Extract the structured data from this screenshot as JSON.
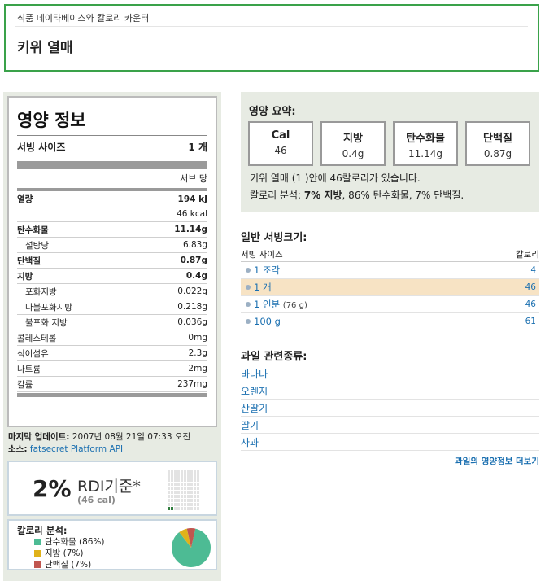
{
  "header": {
    "breadcrumb": "식품 데이타베이스와 칼로리 카운터",
    "title": "키위 열매"
  },
  "facts": {
    "title": "영양 정보",
    "serving_label": "서빙 사이즈",
    "serving_value": "1 개",
    "per_label": "서브 당",
    "energy": {
      "label": "열량",
      "kj": "194 kJ",
      "kcal": "46 kcal"
    },
    "rows": [
      {
        "name": "탄수화물",
        "value": "11.14g",
        "style": "bold"
      },
      {
        "name": "설탕당",
        "value": "6.83g",
        "style": "sub"
      },
      {
        "name": "단백질",
        "value": "0.87g",
        "style": "bold"
      },
      {
        "name": "지방",
        "value": "0.4g",
        "style": "bold"
      },
      {
        "name": "포화지방",
        "value": "0.022g",
        "style": "sub"
      },
      {
        "name": "다불포화지방",
        "value": "0.218g",
        "style": "sub"
      },
      {
        "name": "불포화 지방",
        "value": "0.036g",
        "style": "sub"
      },
      {
        "name": "콜레스테롤",
        "value": "0mg",
        "style": "normal"
      },
      {
        "name": "식이섬유",
        "value": "2.3g",
        "style": "normal"
      },
      {
        "name": "나트륨",
        "value": "2mg",
        "style": "normal"
      },
      {
        "name": "칼륨",
        "value": "237mg",
        "style": "normal"
      }
    ]
  },
  "updated": {
    "label": "마지막 업데이트:",
    "value": "2007년 08월 21일 07:33 오전",
    "source_label": "소스:",
    "source_link": "fatsecret Platform API"
  },
  "rdi": {
    "percent": "2%",
    "label": "RDI기준*",
    "cal": "(46 cal)",
    "fraction": 0.02
  },
  "breakdown": {
    "title": "칼로리 분석:",
    "items": [
      {
        "label": "탄수화물 (86%)",
        "value": 86,
        "color": "#4dbb94"
      },
      {
        "label": "지방 (7%)",
        "value": 7,
        "color": "#e0b21a"
      },
      {
        "label": "단백질 (7%)",
        "value": 7,
        "color": "#c0564f"
      }
    ]
  },
  "summary": {
    "title": "영양 요약:",
    "boxes": [
      {
        "key": "Cal",
        "value": "46"
      },
      {
        "key": "지방",
        "value": "0.4g"
      },
      {
        "key": "탄수화물",
        "value": "11.14g"
      },
      {
        "key": "단백질",
        "value": "0.87g"
      }
    ],
    "line1": "키위 열매 (1 )안에 46칼로리가 있습니다.",
    "line2_prefix": "칼로리 분석: ",
    "line2_bold": "7% 지방",
    "line2_rest": ", 86% 탄수화물, 7% 단백질."
  },
  "servings": {
    "title": "일반 서빙크기:",
    "col_size": "서빙 사이즈",
    "col_cal": "칼로리",
    "rows": [
      {
        "label": "1 조각",
        "note": "",
        "cal": "4",
        "selected": false
      },
      {
        "label": "1 개",
        "note": "",
        "cal": "46",
        "selected": true
      },
      {
        "label": "1 인분",
        "note": "(76 g)",
        "cal": "46",
        "selected": false
      },
      {
        "label": "100 g",
        "note": "",
        "cal": "61",
        "selected": false
      }
    ]
  },
  "related": {
    "title": "과일 관련종류:",
    "items": [
      "바나나",
      "오렌지",
      "산딸기",
      "딸기",
      "사과"
    ],
    "more": "과일의 영양정보 더보기"
  }
}
